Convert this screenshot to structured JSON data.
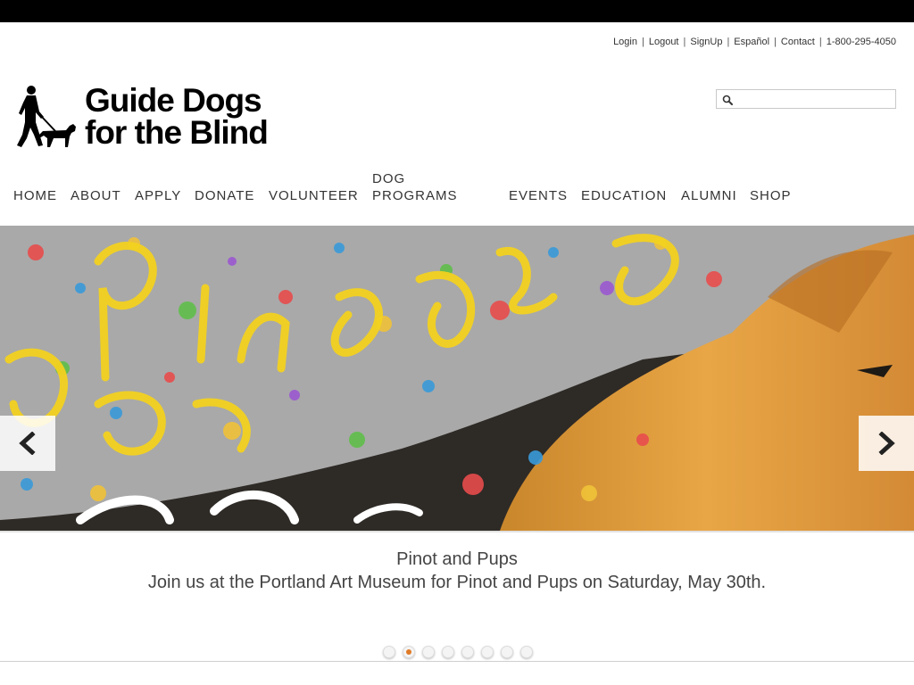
{
  "utility_links": [
    "Login",
    "Logout",
    "SignUp",
    "Español",
    "Contact",
    "1-800-295-4050"
  ],
  "logo": {
    "line1": "Guide Dogs",
    "line2": "for the Blind"
  },
  "search": {
    "placeholder": "",
    "icon": "search-icon"
  },
  "nav": {
    "home": "HOME",
    "about": "ABOUT",
    "apply": "APPLY",
    "donate": "DONATE",
    "volunteer": "VOLUNTEER",
    "dog_programs_line1": "DOG",
    "dog_programs_line2": "PROGRAMS",
    "events": "EVENTS",
    "education": "EDUCATION",
    "alumni": "ALUMNI",
    "shop": "SHOP"
  },
  "hero": {
    "prev_icon": "chevron-left-icon",
    "next_icon": "chevron-right-icon",
    "caption_title": "Pinot and Pups",
    "caption_text": "Join us at the Portland Art Museum for Pinot and Pups on Saturday, May 30th.",
    "slide_count": 8,
    "active_slide": 2
  },
  "colors": {
    "topbar": "#000000",
    "accent_dot": "#e07a26",
    "text": "#333333"
  }
}
